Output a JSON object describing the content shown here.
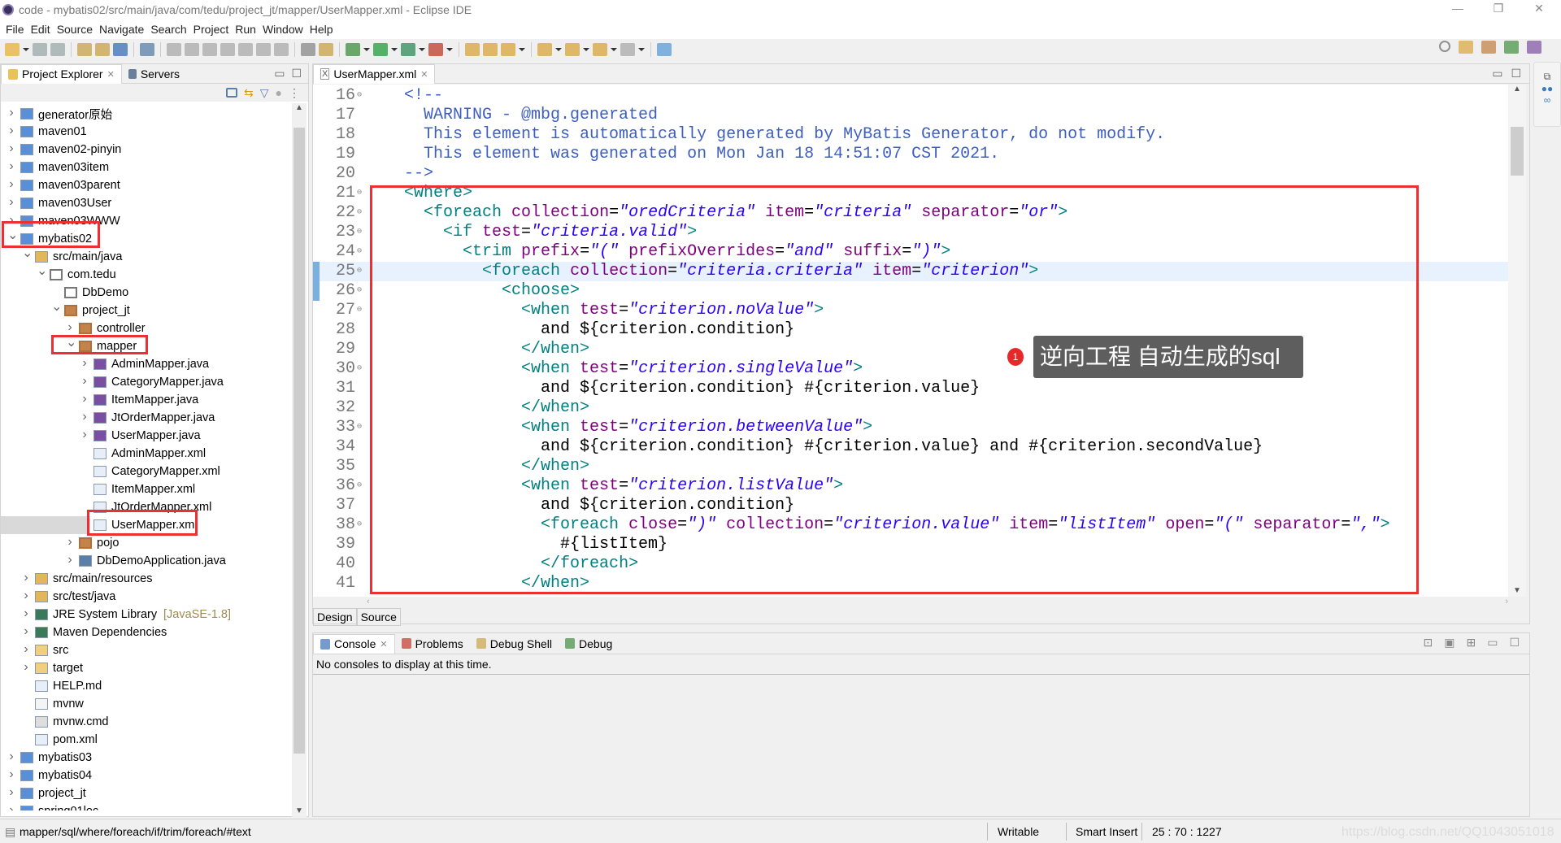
{
  "window": {
    "title": "code - mybatis02/src/main/java/com/tedu/project_jt/mapper/UserMapper.xml - Eclipse IDE",
    "minimize": "—",
    "maximize": "❐",
    "close": "✕"
  },
  "menu": [
    "File",
    "Edit",
    "Source",
    "Navigate",
    "Search",
    "Project",
    "Run",
    "Window",
    "Help"
  ],
  "toolbar_icons": [
    "new-icon",
    "save-icon",
    "save-all-icon",
    "sep",
    "open-type-icon",
    "open-resource-icon",
    "console-icon",
    "sep",
    "skip-breakpoints-icon",
    "sep",
    "resume-icon",
    "suspend-icon",
    "terminate-icon",
    "disconnect-icon",
    "step-into-icon",
    "step-over-icon",
    "step-return-icon",
    "sep",
    "drop-to-frame-icon",
    "use-step-filters-icon",
    "sep",
    "debug-icon",
    "run-icon",
    "coverage-icon",
    "external-tools-icon",
    "sep",
    "new-java-project-icon",
    "open-folder-icon",
    "pen-icon",
    "sep",
    "next-annotation-icon",
    "previous-annotation-icon",
    "back-icon",
    "forward-icon",
    "sep",
    "pin-editor-icon"
  ],
  "perspectives": [
    "search-icon",
    "open-perspective-icon",
    "java-ee-perspective-icon",
    "debug-perspective-icon",
    "java-perspective-icon"
  ],
  "explorer": {
    "tabs": [
      "Project Explorer",
      "Servers"
    ],
    "tree": [
      {
        "label": "generator原始",
        "level": 0,
        "state": "closed",
        "icon": "maven-project"
      },
      {
        "label": "maven01",
        "level": 0,
        "state": "closed",
        "icon": "maven-project-warning"
      },
      {
        "label": "maven02-pinyin",
        "level": 0,
        "state": "closed",
        "icon": "maven-project"
      },
      {
        "label": "maven03item",
        "level": 0,
        "state": "closed",
        "icon": "maven-project"
      },
      {
        "label": "maven03parent",
        "level": 0,
        "state": "closed",
        "icon": "maven-project"
      },
      {
        "label": "maven03User",
        "level": 0,
        "state": "closed",
        "icon": "maven-project"
      },
      {
        "label": "maven03WWW",
        "level": 0,
        "state": "closed",
        "icon": "maven-project"
      },
      {
        "label": "mybatis02",
        "level": 0,
        "state": "open",
        "icon": "maven-project",
        "highlighted": true
      },
      {
        "label": "src/main/java",
        "level": 1,
        "state": "open",
        "icon": "source-folder"
      },
      {
        "label": "com.tedu",
        "level": 2,
        "state": "open",
        "icon": "package-empty"
      },
      {
        "label": "DbDemo",
        "level": 3,
        "state": "none",
        "icon": "package-empty"
      },
      {
        "label": "project_jt",
        "level": 3,
        "state": "open",
        "icon": "package"
      },
      {
        "label": "controller",
        "level": 4,
        "state": "closed",
        "icon": "package"
      },
      {
        "label": "mapper",
        "level": 4,
        "state": "open",
        "icon": "package",
        "highlighted": true
      },
      {
        "label": "AdminMapper.java",
        "level": 5,
        "state": "closed",
        "icon": "java-interface"
      },
      {
        "label": "CategoryMapper.java",
        "level": 5,
        "state": "closed",
        "icon": "java-interface"
      },
      {
        "label": "ItemMapper.java",
        "level": 5,
        "state": "closed",
        "icon": "java-interface"
      },
      {
        "label": "JtOrderMapper.java",
        "level": 5,
        "state": "closed",
        "icon": "java-interface"
      },
      {
        "label": "UserMapper.java",
        "level": 5,
        "state": "closed",
        "icon": "java-interface"
      },
      {
        "label": "AdminMapper.xml",
        "level": 5,
        "state": "none",
        "icon": "xml-file"
      },
      {
        "label": "CategoryMapper.xml",
        "level": 5,
        "state": "none",
        "icon": "xml-file"
      },
      {
        "label": "ItemMapper.xml",
        "level": 5,
        "state": "none",
        "icon": "xml-file"
      },
      {
        "label": "JtOrderMapper.xml",
        "level": 5,
        "state": "none",
        "icon": "xml-file"
      },
      {
        "label": "UserMapper.xml",
        "level": 5,
        "state": "none",
        "icon": "xml-file",
        "selected": true,
        "highlighted": true
      },
      {
        "label": "pojo",
        "level": 4,
        "state": "closed",
        "icon": "package"
      },
      {
        "label": "DbDemoApplication.java",
        "level": 4,
        "state": "closed",
        "icon": "java-file"
      },
      {
        "label": "src/main/resources",
        "level": 1,
        "state": "closed",
        "icon": "source-folder"
      },
      {
        "label": "src/test/java",
        "level": 1,
        "state": "closed",
        "icon": "source-folder"
      },
      {
        "label": "JRE System Library",
        "decoration": "[JavaSE-1.8]",
        "level": 1,
        "state": "closed",
        "icon": "library"
      },
      {
        "label": "Maven Dependencies",
        "level": 1,
        "state": "closed",
        "icon": "library"
      },
      {
        "label": "src",
        "level": 1,
        "state": "closed",
        "icon": "folder"
      },
      {
        "label": "target",
        "level": 1,
        "state": "closed",
        "icon": "folder"
      },
      {
        "label": "HELP.md",
        "level": 1,
        "state": "none",
        "icon": "markdown-file"
      },
      {
        "label": "mvnw",
        "level": 1,
        "state": "none",
        "icon": "text-file"
      },
      {
        "label": "mvnw.cmd",
        "level": 1,
        "state": "none",
        "icon": "cmd-file"
      },
      {
        "label": "pom.xml",
        "level": 1,
        "state": "none",
        "icon": "pom-file"
      },
      {
        "label": "mybatis03",
        "level": 0,
        "state": "closed",
        "icon": "maven-project"
      },
      {
        "label": "mybatis04",
        "level": 0,
        "state": "closed",
        "icon": "maven-project"
      },
      {
        "label": "project_jt",
        "level": 0,
        "state": "closed",
        "icon": "maven-project"
      },
      {
        "label": "spring01loc",
        "level": 0,
        "state": "closed",
        "icon": "maven-project-warning"
      }
    ]
  },
  "editor": {
    "tab": "UserMapper.xml",
    "current_line": 25,
    "bottom_tabs": [
      "Design",
      "Source"
    ],
    "lines": [
      {
        "n": 16,
        "fold": true,
        "s": [
          [
            "c",
            "    <!--"
          ]
        ]
      },
      {
        "n": 17,
        "s": [
          [
            "c",
            "      WARNING - @mbg.generated"
          ]
        ]
      },
      {
        "n": 18,
        "s": [
          [
            "c",
            "      This element is automatically generated by MyBatis Generator, do not modify."
          ]
        ]
      },
      {
        "n": 19,
        "s": [
          [
            "c",
            "      This element was generated on Mon Jan 18 14:51:07 CST 2021."
          ]
        ]
      },
      {
        "n": 20,
        "s": [
          [
            "c",
            "    -->"
          ]
        ]
      },
      {
        "n": 21,
        "fold": true,
        "s": [
          [
            "p",
            "    "
          ],
          [
            "t",
            "<where>"
          ]
        ]
      },
      {
        "n": 22,
        "fold": true,
        "s": [
          [
            "p",
            "      "
          ],
          [
            "t",
            "<foreach "
          ],
          [
            "a",
            "collection"
          ],
          [
            "e",
            "="
          ],
          [
            "v",
            "\"oredCriteria\""
          ],
          [
            "p",
            " "
          ],
          [
            "a",
            "item"
          ],
          [
            "e",
            "="
          ],
          [
            "v",
            "\"criteria\""
          ],
          [
            "p",
            " "
          ],
          [
            "a",
            "separator"
          ],
          [
            "e",
            "="
          ],
          [
            "v",
            "\"or\""
          ],
          [
            "t",
            ">"
          ]
        ]
      },
      {
        "n": 23,
        "fold": true,
        "s": [
          [
            "p",
            "        "
          ],
          [
            "t",
            "<if "
          ],
          [
            "a",
            "test"
          ],
          [
            "e",
            "="
          ],
          [
            "v",
            "\"criteria.valid\""
          ],
          [
            "t",
            ">"
          ]
        ]
      },
      {
        "n": 24,
        "fold": true,
        "s": [
          [
            "p",
            "          "
          ],
          [
            "t",
            "<trim "
          ],
          [
            "a",
            "prefix"
          ],
          [
            "e",
            "="
          ],
          [
            "v",
            "\"(\""
          ],
          [
            "p",
            " "
          ],
          [
            "a",
            "prefixOverrides"
          ],
          [
            "e",
            "="
          ],
          [
            "v",
            "\"and\""
          ],
          [
            "p",
            " "
          ],
          [
            "a",
            "suffix"
          ],
          [
            "e",
            "="
          ],
          [
            "v",
            "\")\""
          ],
          [
            "t",
            ">"
          ]
        ]
      },
      {
        "n": 25,
        "fold": true,
        "s": [
          [
            "p",
            "            "
          ],
          [
            "t",
            "<foreach "
          ],
          [
            "a",
            "collection"
          ],
          [
            "e",
            "="
          ],
          [
            "v",
            "\"criteria.criteria\""
          ],
          [
            "p",
            " "
          ],
          [
            "a",
            "item"
          ],
          [
            "e",
            "="
          ],
          [
            "v",
            "\"criterion\""
          ],
          [
            "t",
            ">"
          ]
        ]
      },
      {
        "n": 26,
        "fold": true,
        "s": [
          [
            "p",
            "              "
          ],
          [
            "t",
            "<choose>"
          ]
        ]
      },
      {
        "n": 27,
        "fold": true,
        "s": [
          [
            "p",
            "                "
          ],
          [
            "t",
            "<when "
          ],
          [
            "a",
            "test"
          ],
          [
            "e",
            "="
          ],
          [
            "v",
            "\"criterion.noValue\""
          ],
          [
            "t",
            ">"
          ]
        ]
      },
      {
        "n": 28,
        "s": [
          [
            "p",
            "                  and ${criterion.condition}"
          ]
        ]
      },
      {
        "n": 29,
        "s": [
          [
            "p",
            "                "
          ],
          [
            "t",
            "</when>"
          ]
        ]
      },
      {
        "n": 30,
        "fold": true,
        "s": [
          [
            "p",
            "                "
          ],
          [
            "t",
            "<when "
          ],
          [
            "a",
            "test"
          ],
          [
            "e",
            "="
          ],
          [
            "v",
            "\"criterion.singleValue\""
          ],
          [
            "t",
            ">"
          ]
        ]
      },
      {
        "n": 31,
        "s": [
          [
            "p",
            "                  and ${criterion.condition} #{criterion.value}"
          ]
        ]
      },
      {
        "n": 32,
        "s": [
          [
            "p",
            "                "
          ],
          [
            "t",
            "</when>"
          ]
        ]
      },
      {
        "n": 33,
        "fold": true,
        "s": [
          [
            "p",
            "                "
          ],
          [
            "t",
            "<when "
          ],
          [
            "a",
            "test"
          ],
          [
            "e",
            "="
          ],
          [
            "v",
            "\"criterion.betweenValue\""
          ],
          [
            "t",
            ">"
          ]
        ]
      },
      {
        "n": 34,
        "s": [
          [
            "p",
            "                  and ${criterion.condition} #{criterion.value} and #{criterion.secondValue}"
          ]
        ]
      },
      {
        "n": 35,
        "s": [
          [
            "p",
            "                "
          ],
          [
            "t",
            "</when>"
          ]
        ]
      },
      {
        "n": 36,
        "fold": true,
        "s": [
          [
            "p",
            "                "
          ],
          [
            "t",
            "<when "
          ],
          [
            "a",
            "test"
          ],
          [
            "e",
            "="
          ],
          [
            "v",
            "\"criterion.listValue\""
          ],
          [
            "t",
            ">"
          ]
        ]
      },
      {
        "n": 37,
        "s": [
          [
            "p",
            "                  and ${criterion.condition}"
          ]
        ]
      },
      {
        "n": 38,
        "fold": true,
        "s": [
          [
            "p",
            "                  "
          ],
          [
            "t",
            "<foreach "
          ],
          [
            "a",
            "close"
          ],
          [
            "e",
            "="
          ],
          [
            "v",
            "\")\""
          ],
          [
            "p",
            " "
          ],
          [
            "a",
            "collection"
          ],
          [
            "e",
            "="
          ],
          [
            "v",
            "\"criterion.value\""
          ],
          [
            "p",
            " "
          ],
          [
            "a",
            "item"
          ],
          [
            "e",
            "="
          ],
          [
            "v",
            "\"listItem\""
          ],
          [
            "p",
            " "
          ],
          [
            "a",
            "open"
          ],
          [
            "e",
            "="
          ],
          [
            "v",
            "\"(\""
          ],
          [
            "p",
            " "
          ],
          [
            "a",
            "separator"
          ],
          [
            "e",
            "="
          ],
          [
            "v",
            "\",\""
          ],
          [
            "t",
            ">"
          ]
        ]
      },
      {
        "n": 39,
        "s": [
          [
            "p",
            "                    #{listItem}"
          ]
        ]
      },
      {
        "n": 40,
        "s": [
          [
            "p",
            "                  "
          ],
          [
            "t",
            "</foreach>"
          ]
        ]
      },
      {
        "n": 41,
        "s": [
          [
            "p",
            "                "
          ],
          [
            "t",
            "</when>"
          ]
        ]
      }
    ]
  },
  "annotation": {
    "number": "1",
    "text": "逆向工程 自动生成的sql",
    "color": "#e62828"
  },
  "console": {
    "tabs": [
      "Console",
      "Problems",
      "Debug Shell",
      "Debug"
    ],
    "message": "No consoles to display at this time."
  },
  "status": {
    "path": "mapper/sql/where/foreach/if/trim/foreach/#text",
    "writable": "Writable",
    "insert_mode": "Smart Insert",
    "position": "25 : 70 : 1227",
    "watermark": "https://blog.csdn.net/QQ1043051018"
  },
  "colors": {
    "highlight_box": "#ec2f32",
    "tag": "#008080",
    "attribute": "#7f007f",
    "value": "#2a00ff",
    "comment": "#3f5fbf",
    "current_line": "#e8f2fe"
  }
}
